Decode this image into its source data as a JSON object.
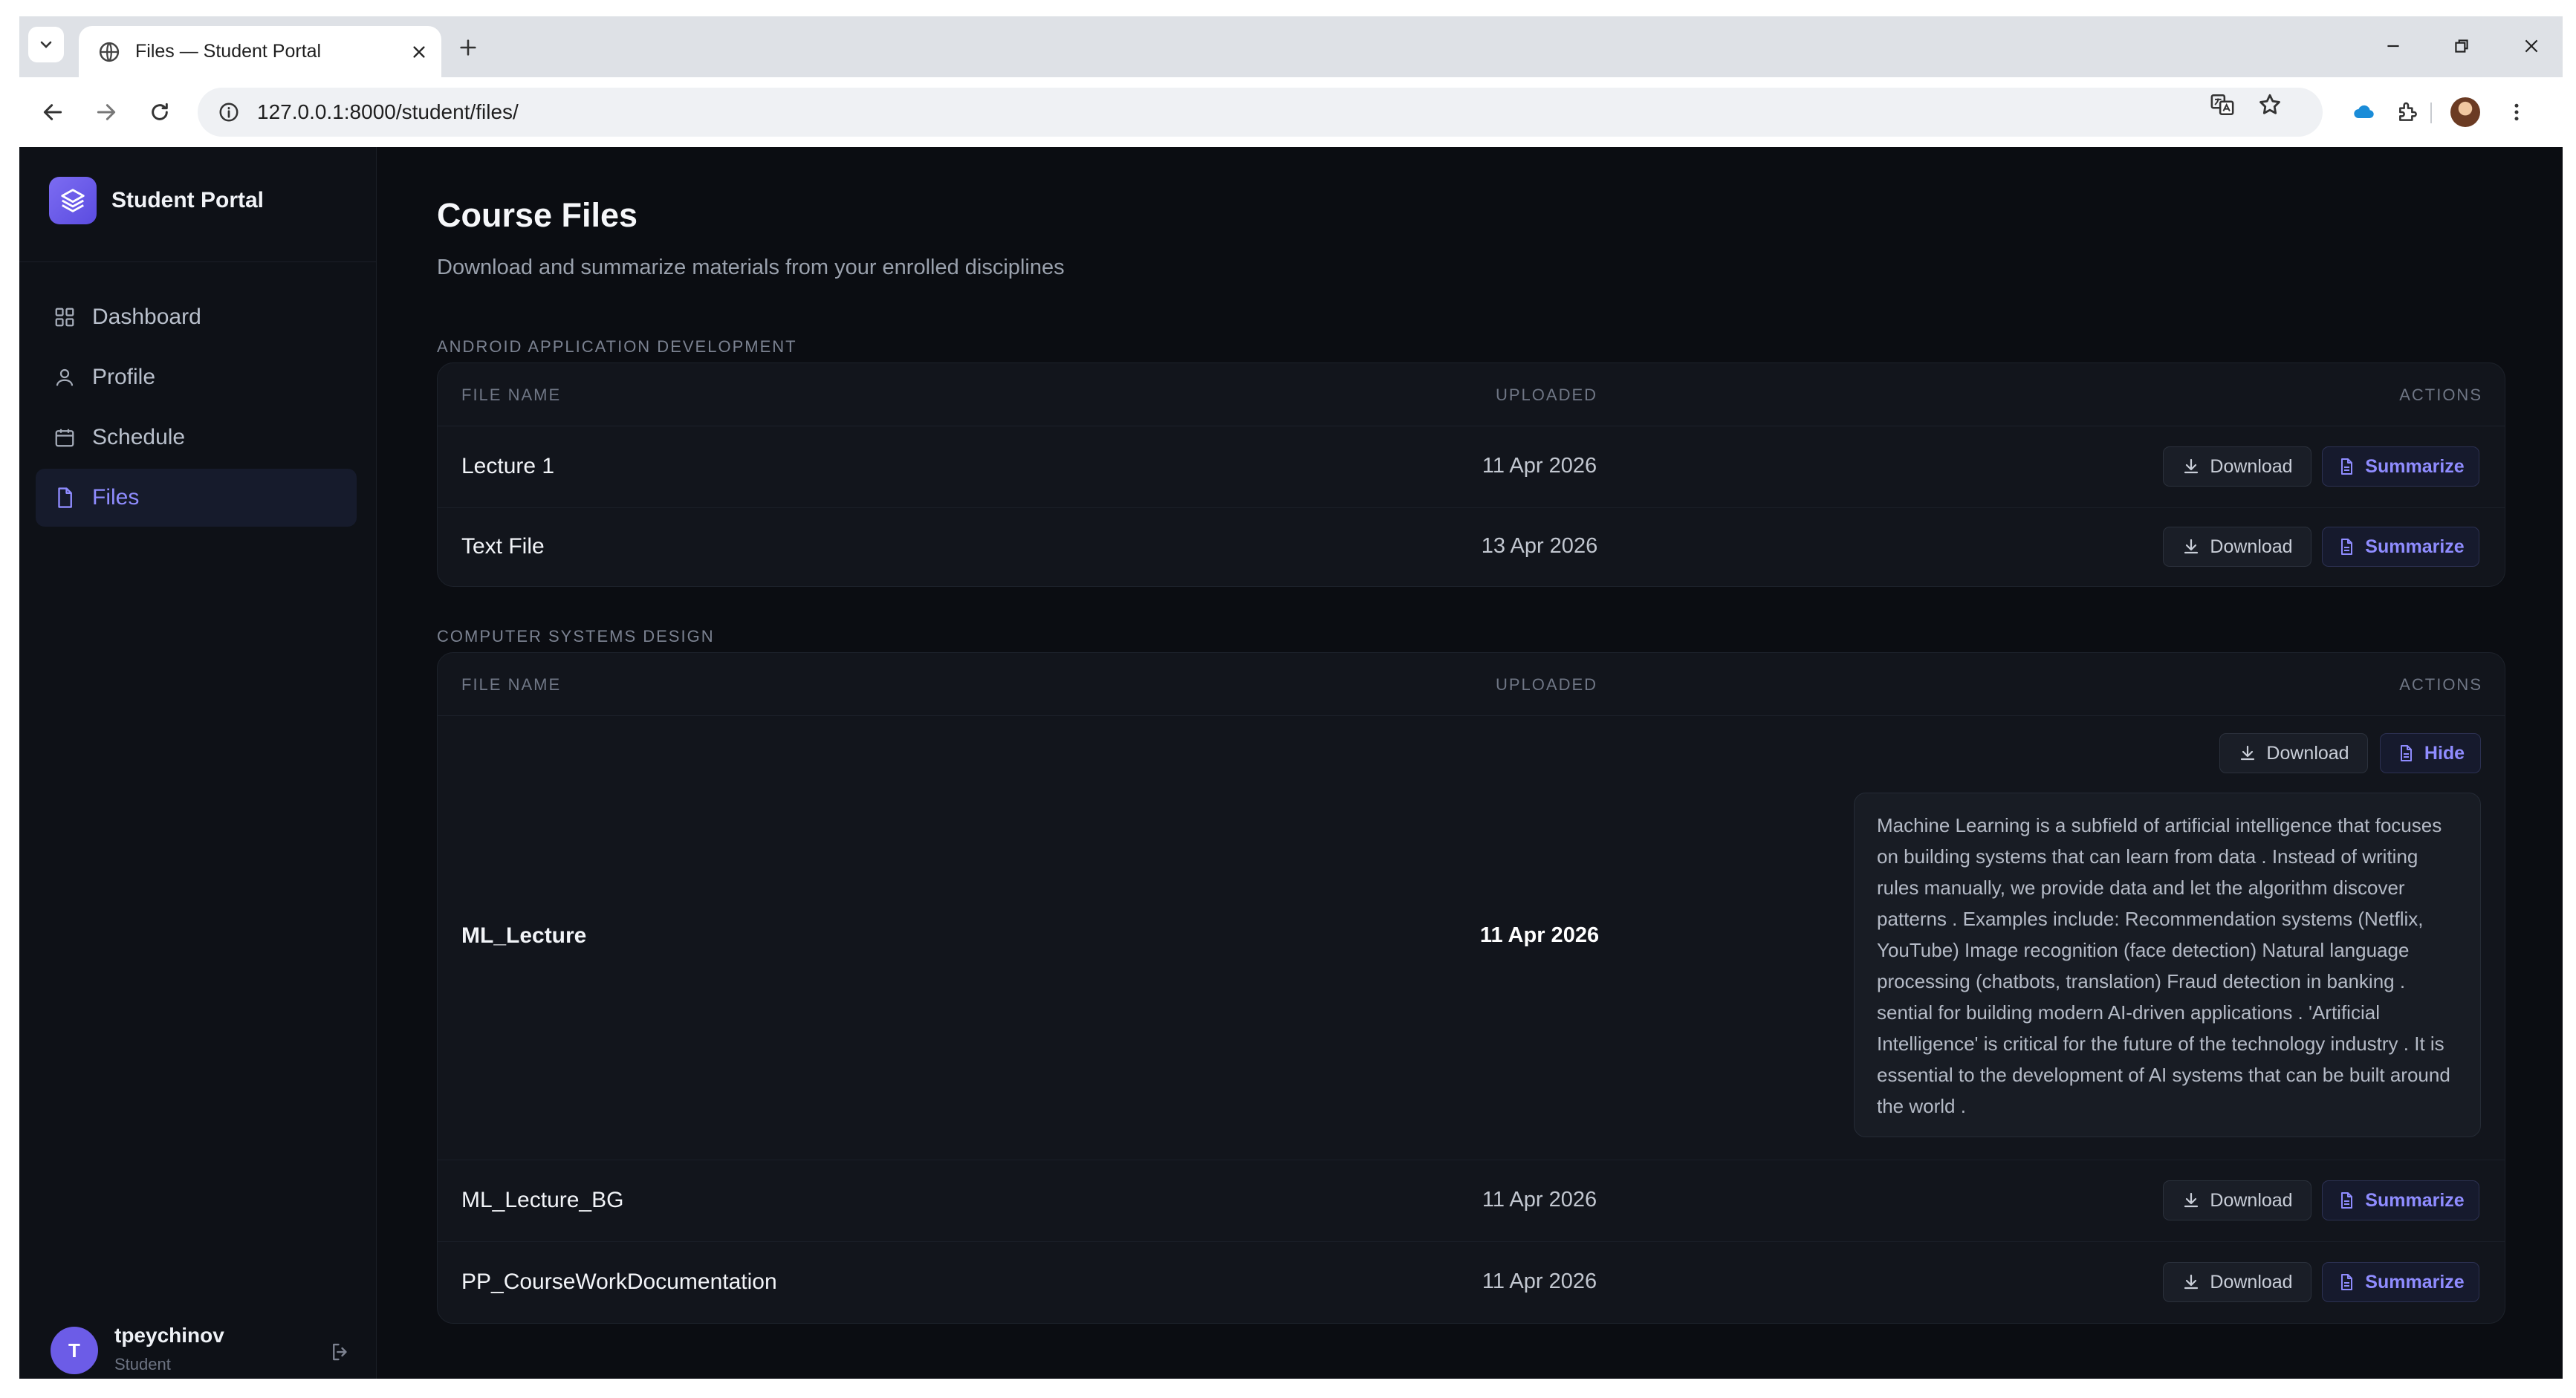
{
  "browser": {
    "tab_title": "Files — Student Portal",
    "url": "127.0.0.1:8000/student/files/",
    "icons": [
      "tab-search-icon",
      "globe-icon",
      "close-icon",
      "plus-icon",
      "minimize-icon",
      "restore-icon",
      "window-close-icon",
      "back-icon",
      "forward-icon",
      "reload-icon",
      "site-info-icon",
      "translate-icon",
      "star-icon",
      "cloud-icon",
      "extensions-icon",
      "profile-avatar",
      "kebab-menu-icon"
    ]
  },
  "app": {
    "brand": "Student Portal",
    "nav": [
      {
        "label": "Dashboard",
        "icon": "grid-icon",
        "active": false
      },
      {
        "label": "Profile",
        "icon": "user-icon",
        "active": false
      },
      {
        "label": "Schedule",
        "icon": "calendar-icon",
        "active": false
      },
      {
        "label": "Files",
        "icon": "file-icon",
        "active": true
      }
    ],
    "user": {
      "initial": "T",
      "name": "tpeychinov",
      "role": "Student"
    }
  },
  "main": {
    "title": "Course Files",
    "subtitle": "Download and summarize materials from your enrolled disciplines",
    "columns": {
      "name": "FILE NAME",
      "uploaded": "UPLOADED",
      "actions": "ACTIONS"
    },
    "buttons": {
      "download": "Download",
      "summarize": "Summarize",
      "hide": "Hide"
    },
    "sections": [
      {
        "label": "ANDROID APPLICATION DEVELOPMENT",
        "files": [
          {
            "name": "Lecture 1",
            "date": "11 Apr 2026"
          },
          {
            "name": "Text File",
            "date": "13 Apr 2026"
          }
        ]
      },
      {
        "label": "COMPUTER SYSTEMS DESIGN",
        "files": [
          {
            "name": "ML_Lecture",
            "date": "11 Apr 2026",
            "expanded": true,
            "summary": " Machine Learning is a subfield of artificial intelligence that focuses on building systems that can learn from data . Instead of writing rules manually, we provide data and let the algorithm discover patterns . Examples include: Recommendation systems (Netflix, YouTube) Image recognition (face detection) Natural language processing (chatbots, translation) Fraud detection in banking . sential for building modern AI-driven applications . 'Artificial Intelligence' is critical for the future of the technology industry . It is essential to the development of AI systems that can be built around the world ."
          },
          {
            "name": "ML_Lecture_BG",
            "date": "11 Apr 2026"
          },
          {
            "name": "PP_CourseWorkDocumentation",
            "date": "11 Apr 2026"
          }
        ]
      }
    ]
  },
  "colors": {
    "accent": "#8f8cff",
    "brand": "#6c5ce7",
    "background": "#0b0d12",
    "card": "#12151c"
  }
}
